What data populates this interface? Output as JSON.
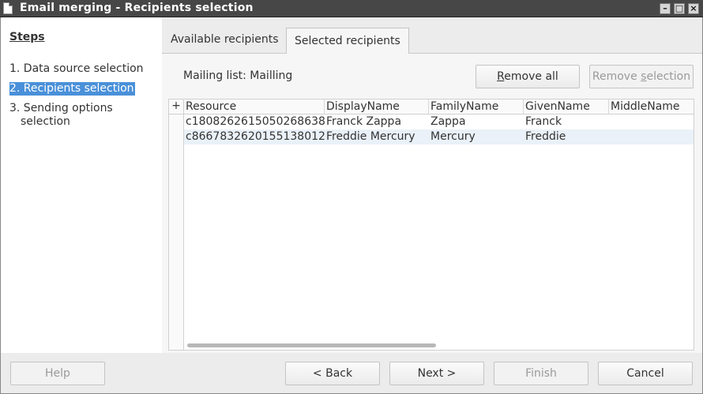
{
  "window": {
    "title": "Email merging - Recipients selection",
    "controls": {
      "minimize": "–",
      "maximize": "□",
      "close": "×"
    }
  },
  "steps": {
    "heading": "Steps",
    "items": [
      {
        "label": "1. Data source selection"
      },
      {
        "label": "2. Recipients selection"
      },
      {
        "label_line1": "3. Sending options",
        "label_line2": "selection"
      }
    ]
  },
  "tabs": [
    {
      "label": "Available recipients"
    },
    {
      "label": "Selected recipients"
    }
  ],
  "mailing_list": {
    "label": "Mailing list: Mailling"
  },
  "actions": {
    "remove_all_prefix": "",
    "remove_all_mnemonic": "R",
    "remove_all_rest": "emove all",
    "remove_selection_prefix": "Remove ",
    "remove_selection_mnemonic": "s",
    "remove_selection_rest": "election"
  },
  "table": {
    "corner_label": "+",
    "columns": [
      "Resource",
      "DisplayName",
      "FamilyName",
      "GivenName",
      "MiddleName"
    ],
    "rows": [
      {
        "resource": "c1808262615050268638",
        "display": "Franck Zappa",
        "family": "Zappa",
        "given": "Franck",
        "middle": ""
      },
      {
        "resource": "c8667832620155138012",
        "display": "Freddie Mercury",
        "family": "Mercury",
        "given": "Freddie",
        "middle": ""
      }
    ]
  },
  "footer": {
    "help": "Help",
    "back": "< Back",
    "next": "Next >",
    "finish": "Finish",
    "cancel": "Cancel"
  }
}
